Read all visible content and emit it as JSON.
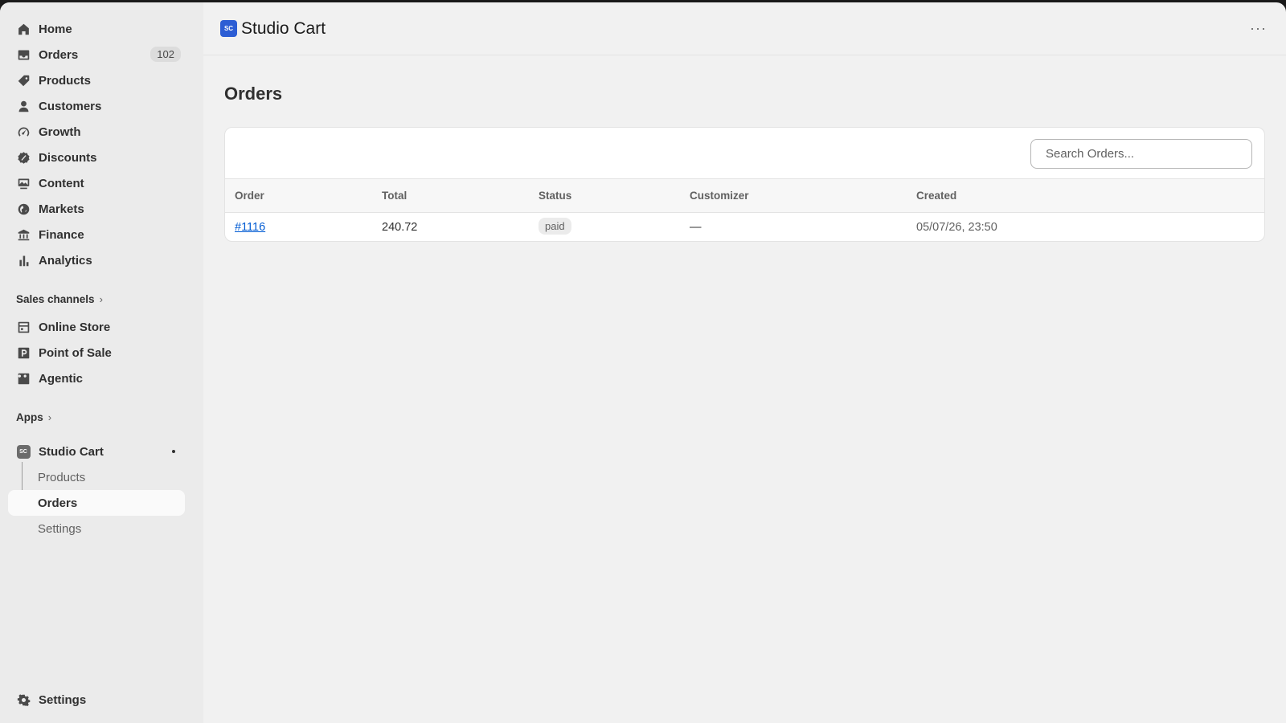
{
  "sidebar": {
    "items": [
      {
        "label": "Home",
        "icon": "home-icon"
      },
      {
        "label": "Orders",
        "icon": "inbox-icon",
        "badge": "102"
      },
      {
        "label": "Products",
        "icon": "tag-icon"
      },
      {
        "label": "Customers",
        "icon": "person-icon"
      },
      {
        "label": "Growth",
        "icon": "gauge-icon"
      },
      {
        "label": "Discounts",
        "icon": "discount-icon"
      },
      {
        "label": "Content",
        "icon": "content-icon"
      },
      {
        "label": "Markets",
        "icon": "globe-icon"
      },
      {
        "label": "Finance",
        "icon": "bank-icon"
      },
      {
        "label": "Analytics",
        "icon": "bar-chart-icon"
      }
    ],
    "sales_channels_label": "Sales channels",
    "channels": [
      {
        "label": "Online Store",
        "icon": "store-icon"
      },
      {
        "label": "Point of Sale",
        "icon": "pos-icon"
      },
      {
        "label": "Agentic",
        "icon": "agentic-icon"
      }
    ],
    "apps_label": "Apps",
    "app": {
      "name": "Studio Cart",
      "icon_text": "SC",
      "sub_items": [
        "Products",
        "Orders",
        "Settings"
      ],
      "active_sub": "Orders"
    },
    "settings_label": "Settings"
  },
  "header": {
    "logo_text": "SC",
    "title": "Studio Cart",
    "more": "···"
  },
  "page": {
    "title": "Orders",
    "search_placeholder": "Search Orders...",
    "columns": [
      "Order",
      "Total",
      "Status",
      "Customizer",
      "Created"
    ],
    "rows": [
      {
        "order": "#1116",
        "total": "240.72",
        "status": "paid",
        "customizer": "—",
        "created": "05/07/26, 23:50"
      }
    ]
  },
  "colors": {
    "accent": "#2c5dd4",
    "link": "#005bd3"
  }
}
